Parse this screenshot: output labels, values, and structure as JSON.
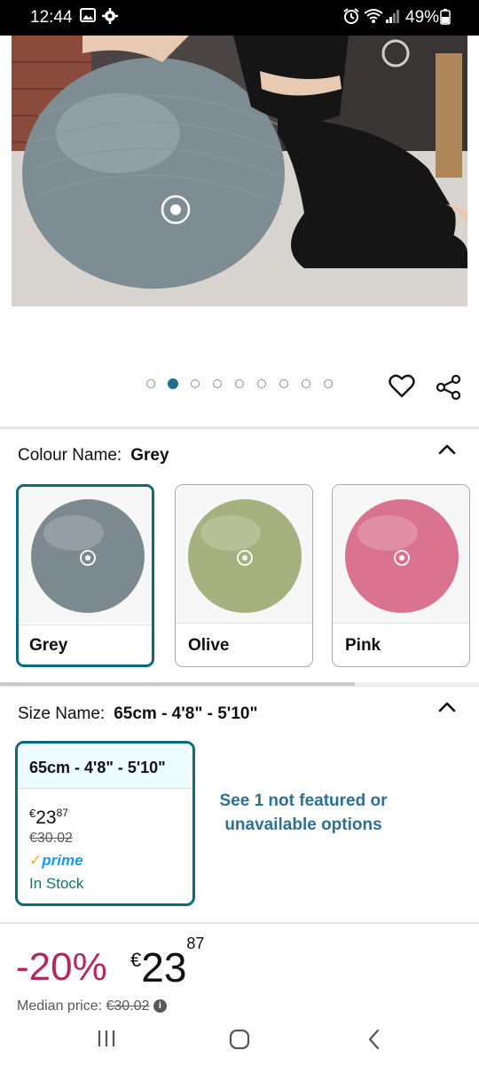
{
  "status_bar": {
    "time": "12:44",
    "battery": "49%"
  },
  "carousel": {
    "dot_count": 9,
    "active_index": 1
  },
  "colour_section": {
    "label": "Colour Name:",
    "value": "Grey",
    "options": [
      {
        "label": "Grey",
        "color": "#7c8a90",
        "selected": true
      },
      {
        "label": "Olive",
        "color": "#a5b17e",
        "selected": false
      },
      {
        "label": "Pink",
        "color": "#d9738f",
        "selected": false
      }
    ]
  },
  "size_section": {
    "label": "Size Name:",
    "value": "65cm - 4'8\" - 5'10\"",
    "card": {
      "title": "65cm - 4'8\" - 5'10\"",
      "price_currency": "€",
      "price_whole": "23",
      "price_fraction": "87",
      "was_price": "€30.02",
      "prime_check": "✓",
      "prime_label": "prime",
      "stock": "In Stock"
    },
    "see_more": "See 1 not featured or unavailable options"
  },
  "pricing": {
    "discount": "-20%",
    "currency": "€",
    "whole": "23",
    "fraction": "87",
    "median_label": "Median price:",
    "median_value": "€30.02",
    "info_glyph": "i"
  }
}
